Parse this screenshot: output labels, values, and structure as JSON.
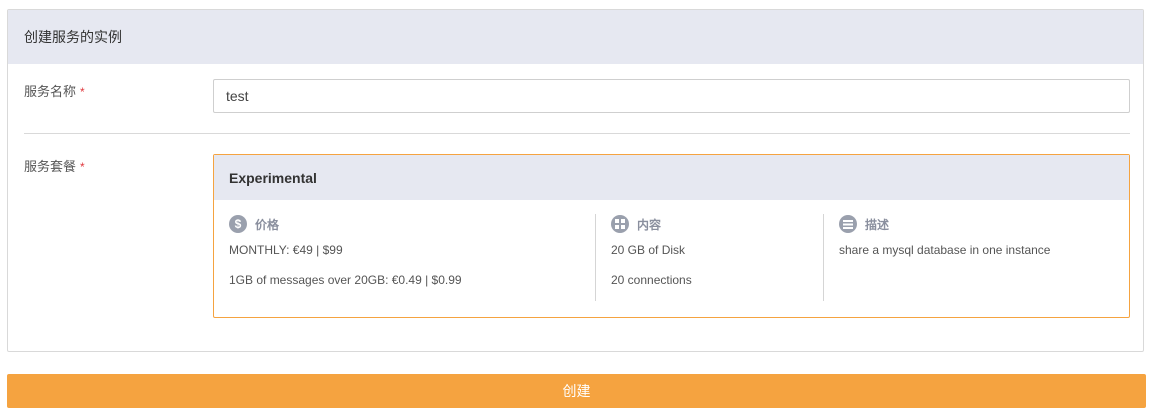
{
  "panel": {
    "title": "创建服务的实例"
  },
  "form": {
    "name_label": "服务名称",
    "name_value": "test",
    "required_mark": "*",
    "plan_label": "服务套餐"
  },
  "plan": {
    "name": "Experimental",
    "price": {
      "title": "价格",
      "icon": "dollar-icon",
      "lines": [
        "MONTHLY: €49 | $99",
        "1GB of messages over 20GB: €0.49 | $0.99"
      ]
    },
    "content": {
      "title": "内容",
      "icon": "grid-icon",
      "lines": [
        "20 GB of Disk",
        "20 connections"
      ]
    },
    "description": {
      "title": "描述",
      "icon": "list-icon",
      "lines": [
        "share a mysql database in one instance"
      ]
    }
  },
  "actions": {
    "create_label": "创建"
  },
  "colors": {
    "accent": "#f5a340",
    "header_bg": "#e6e8f1",
    "required": "#e0393e"
  }
}
